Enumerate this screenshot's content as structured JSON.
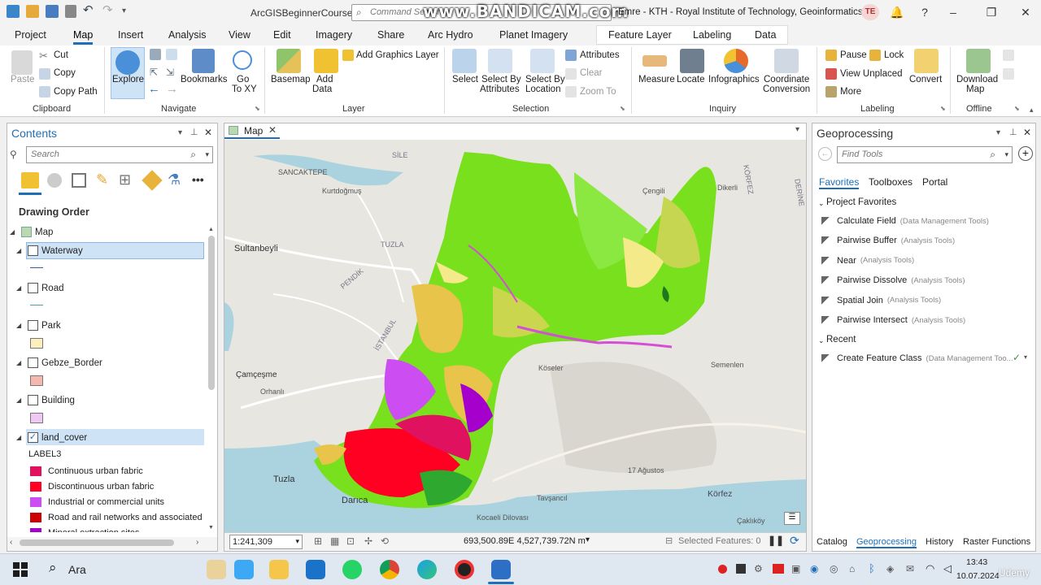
{
  "titlebar": {
    "app_name": "ArcGISBeginnerCourse",
    "command_search_placeholder": "Command Search",
    "watermark": "www.BANDICAM.com",
    "user_text": "Emre - KTH - Royal Institute of Technology, Geoinformatics",
    "avatar_initials": "TE"
  },
  "menu": {
    "tabs": [
      "Project",
      "Map",
      "Insert",
      "Analysis",
      "View",
      "Edit",
      "Imagery",
      "Share",
      "Arc Hydro",
      "Planet Imagery",
      "Feature Layer",
      "Labeling",
      "Data"
    ],
    "active": "Map"
  },
  "ribbon": {
    "clipboard": {
      "paste": "Paste",
      "cut": "Cut",
      "copy": "Copy",
      "copy_path": "Copy Path",
      "group": "Clipboard"
    },
    "navigate": {
      "explore": "Explore",
      "bookmarks": "Bookmarks",
      "go_to_xy": "Go\nTo XY",
      "go_to": "Go",
      "to_xy": "To XY",
      "group": "Navigate"
    },
    "layer": {
      "basemap": "Basemap",
      "add": "Add",
      "data": "Data",
      "add_graphics": "Add Graphics Layer",
      "group": "Layer"
    },
    "selection": {
      "select": "Select",
      "select_by": "Select By",
      "attributes": "Attributes",
      "location": "Location",
      "attributes_btn": "Attributes",
      "clear": "Clear",
      "zoom_to": "Zoom To",
      "group": "Selection"
    },
    "inquiry": {
      "measure": "Measure",
      "locate": "Locate",
      "infographics": "Infographics",
      "coordinate": "Coordinate",
      "conversion": "Conversion",
      "group": "Inquiry"
    },
    "labeling": {
      "pause": "Pause",
      "lock": "Lock",
      "view_unplaced": "View Unplaced",
      "more": "More",
      "convert": "Convert",
      "group": "Labeling"
    },
    "offline": {
      "download": "Download",
      "map": "Map",
      "group": "Offline"
    }
  },
  "contents": {
    "title": "Contents",
    "search_placeholder": "Search",
    "drawing_order": "Drawing Order",
    "map_label": "Map",
    "layers": [
      {
        "name": "Waterway",
        "checked": false,
        "selected": true
      },
      {
        "name": "Road",
        "checked": false
      },
      {
        "name": "Park",
        "checked": false
      },
      {
        "name": "Gebze_Border",
        "checked": false
      },
      {
        "name": "Building",
        "checked": false
      },
      {
        "name": "land_cover",
        "checked": true,
        "selected": true
      }
    ],
    "check_mark": "✓",
    "legend_field": "LABEL3",
    "legend": [
      {
        "label": "Continuous urban fabric",
        "color": "#e0115f"
      },
      {
        "label": "Discontinuous urban fabric",
        "color": "#ff0022"
      },
      {
        "label": "Industrial or commercial units",
        "color": "#cc4df2"
      },
      {
        "label": "Road and rail networks and associated",
        "color": "#cc0000"
      },
      {
        "label": "Mineral extraction sites",
        "color": "#a600cc"
      }
    ]
  },
  "map": {
    "tab_label": "Map",
    "scale": "1:241,309",
    "coordinates": "693,500.89E 4,527,739.72N m",
    "selected_features": "Selected Features: 0",
    "place_labels": [
      "SANCAKTEPE",
      "Kurtdoğmuş",
      "Sultanbeyli",
      "TUZLA",
      "PENDİK",
      "İSTANBUL",
      "Çamçeşme",
      "Orhanlı",
      "Tuzla",
      "Darıca",
      "Çengili",
      "Dikerli",
      "KÖRFEZ",
      "Köseler",
      "Semenlen",
      "17 Ağustos",
      "Tavşancıl",
      "Körfez",
      "Çaklıköy",
      "Kocaeli Dilovası",
      "SİLE",
      "DERİNE"
    ]
  },
  "geoprocessing": {
    "title": "Geoprocessing",
    "search_placeholder": "Find Tools",
    "tabs": [
      "Favorites",
      "Toolboxes",
      "Portal"
    ],
    "project_favorites": "Project Favorites",
    "favorites": [
      {
        "name": "Calculate Field",
        "toolbox": "(Data Management Tools)"
      },
      {
        "name": "Pairwise Buffer",
        "toolbox": "(Analysis Tools)"
      },
      {
        "name": "Near",
        "toolbox": "(Analysis Tools)"
      },
      {
        "name": "Pairwise Dissolve",
        "toolbox": "(Analysis Tools)"
      },
      {
        "name": "Spatial Join",
        "toolbox": "(Analysis Tools)"
      },
      {
        "name": "Pairwise Intersect",
        "toolbox": "(Analysis Tools)"
      }
    ],
    "recent_label": "Recent",
    "recent": [
      {
        "name": "Create Feature Class",
        "toolbox": "(Data Management Too..."
      }
    ],
    "bottom_tabs": [
      "Catalog",
      "Geoprocessing",
      "History",
      "Raster Functions"
    ]
  },
  "taskbar": {
    "search_text": "Ara",
    "time": "13:43",
    "date": "10.07.2024",
    "watermark": "Udemy"
  },
  "colors": {
    "accent": "#1e6fb8",
    "selection": "#cfe3f6"
  }
}
